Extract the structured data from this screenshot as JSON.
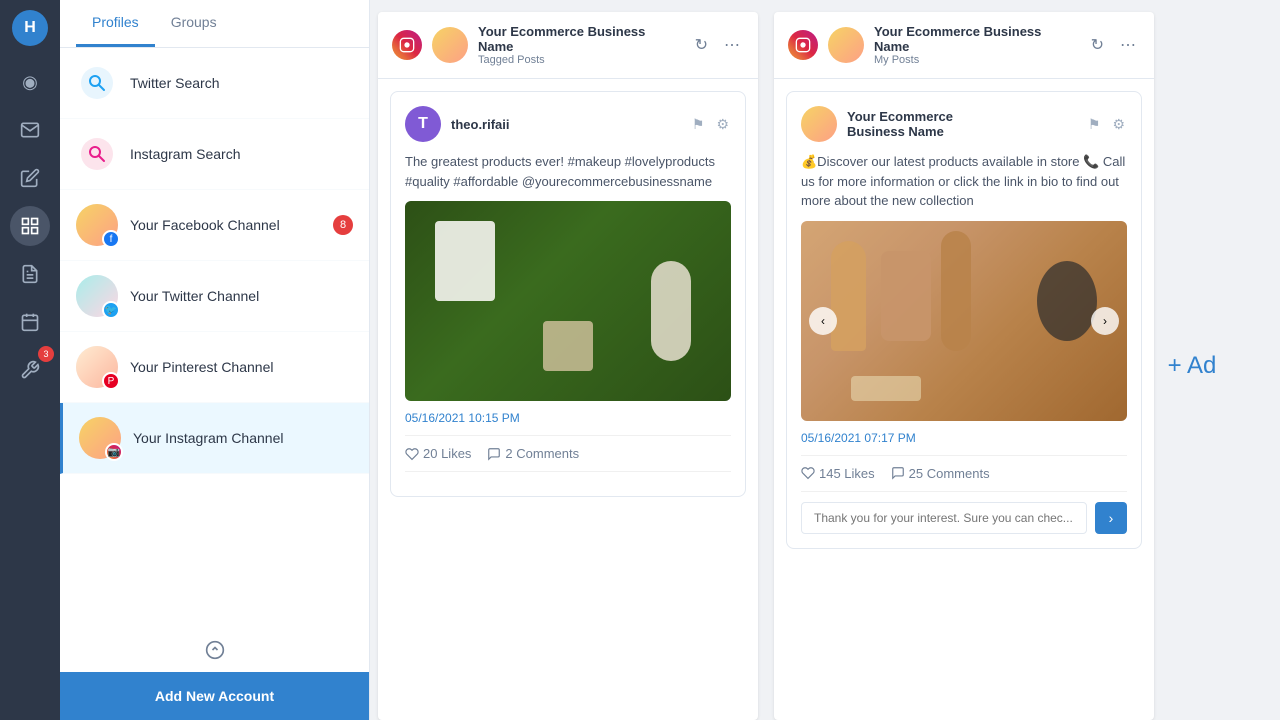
{
  "nav": {
    "logo": "H",
    "items": [
      {
        "name": "dashboard",
        "icon": "◉",
        "active": false
      },
      {
        "name": "inbox",
        "icon": "✉",
        "active": false
      },
      {
        "name": "compose",
        "icon": "✏",
        "active": false
      },
      {
        "name": "streams",
        "icon": "⊞",
        "active": true
      },
      {
        "name": "reports",
        "icon": "📋",
        "active": false
      },
      {
        "name": "schedule",
        "icon": "📅",
        "active": false
      },
      {
        "name": "tools",
        "icon": "✂",
        "active": false
      }
    ]
  },
  "sidebar": {
    "tabs": [
      {
        "label": "Profiles",
        "active": true
      },
      {
        "label": "Groups",
        "active": false
      }
    ],
    "items": [
      {
        "id": "twitter-search",
        "label": "Twitter Search",
        "type": "search",
        "social": "twitter",
        "badge": null
      },
      {
        "id": "instagram-search",
        "label": "Instagram Search",
        "type": "search",
        "social": "instagram",
        "badge": null
      },
      {
        "id": "facebook-channel",
        "label": "Your Facebook Channel",
        "type": "channel",
        "social": "facebook",
        "badge": "8"
      },
      {
        "id": "twitter-channel",
        "label": "Your Twitter Channel",
        "type": "channel",
        "social": "twitter",
        "badge": null
      },
      {
        "id": "pinterest-channel",
        "label": "Your Pinterest Channel",
        "type": "channel",
        "social": "pinterest",
        "badge": null
      },
      {
        "id": "instagram-channel",
        "label": "Your Instagram Channel",
        "type": "channel",
        "social": "instagram",
        "badge": null,
        "active": true
      }
    ],
    "add_btn": "Add New Account"
  },
  "columns": [
    {
      "id": "col1",
      "platform": "instagram",
      "account_name": "Your Ecommerce Business Name",
      "col_type": "Tagged Posts",
      "posts": [
        {
          "id": "post1",
          "author": "theo.rifaii",
          "avatar_letter": "T",
          "avatar_color": "#805ad5",
          "text": "The greatest products ever! #makeup #lovelyproducts #quality #affordable @yourecommercebusinessname",
          "image_type": "green-product",
          "timestamp": "05/16/2021 10:15 PM",
          "likes": "20 Likes",
          "comments": "2 Comments"
        }
      ]
    },
    {
      "id": "col2",
      "platform": "instagram",
      "account_name": "Your Ecommerce Business Name",
      "col_type": "My Posts",
      "posts": [
        {
          "id": "post2",
          "author": "Your Ecommerce\nBusiness Name",
          "avatar_type": "gradient",
          "text": "💰Discover our latest products available in store 📞 Call us for more information or click the link in bio to find out more about the new collection",
          "image_type": "cosmetics",
          "timestamp": "05/16/2021 07:17 PM",
          "likes": "145 Likes",
          "comments": "25 Comments",
          "reply_placeholder": "Thank you for your interest. Sure you can chec..."
        }
      ]
    }
  ],
  "add_column_label": "+ Ad"
}
